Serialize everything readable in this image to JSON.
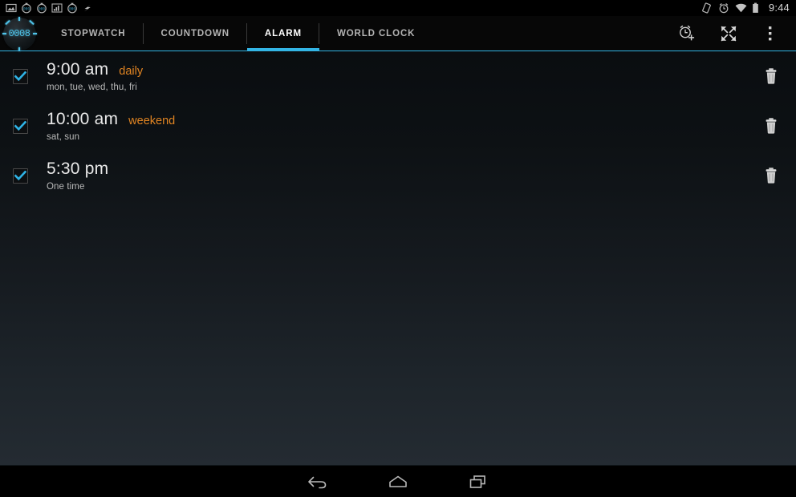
{
  "status_bar": {
    "notification_icons": [
      "screenshot-icon",
      "stopwatch-icon",
      "stopwatch-icon",
      "signal-bars-icon",
      "stopwatch-icon",
      "charging-bolt-icon"
    ],
    "system_icons": [
      "rotation-lock-icon",
      "alarm-set-icon",
      "wifi-icon",
      "battery-icon"
    ],
    "clock": "9:44"
  },
  "action_bar": {
    "logo": {
      "name": "stopwatch-app-logo",
      "digits": "0008"
    },
    "tabs": [
      {
        "label": "STOPWATCH",
        "name": "tab-stopwatch",
        "active": false
      },
      {
        "label": "COUNTDOWN",
        "name": "tab-countdown",
        "active": false
      },
      {
        "label": "ALARM",
        "name": "tab-alarm",
        "active": true
      },
      {
        "label": "WORLD CLOCK",
        "name": "tab-world-clock",
        "active": false
      }
    ],
    "actions": [
      {
        "name": "add-alarm-button",
        "icon": "alarm-add-icon"
      },
      {
        "name": "fullscreen-button",
        "icon": "expand-arrows-icon"
      },
      {
        "name": "overflow-menu-button",
        "icon": "more-vertical-icon"
      }
    ]
  },
  "alarms": [
    {
      "time": "9:00 am",
      "label": "daily",
      "days": "mon, tue, wed, thu, fri",
      "enabled": true,
      "delete_icon": "trash-icon"
    },
    {
      "time": "10:00 am",
      "label": "weekend",
      "days": "sat, sun",
      "enabled": true,
      "delete_icon": "trash-icon"
    },
    {
      "time": "5:30 pm",
      "label": "",
      "days": "One time",
      "enabled": true,
      "delete_icon": "trash-icon"
    }
  ],
  "nav_bar": {
    "buttons": [
      {
        "name": "nav-back-button",
        "icon": "back-arrow-icon"
      },
      {
        "name": "nav-home-button",
        "icon": "home-icon"
      },
      {
        "name": "nav-recents-button",
        "icon": "recents-icon"
      }
    ]
  },
  "colors": {
    "accent": "#33b5e5",
    "label_orange": "#e08422",
    "time_text": "#e9e9e9",
    "days_text": "#b9b9b9",
    "tab_inactive": "#b4b4b4"
  }
}
